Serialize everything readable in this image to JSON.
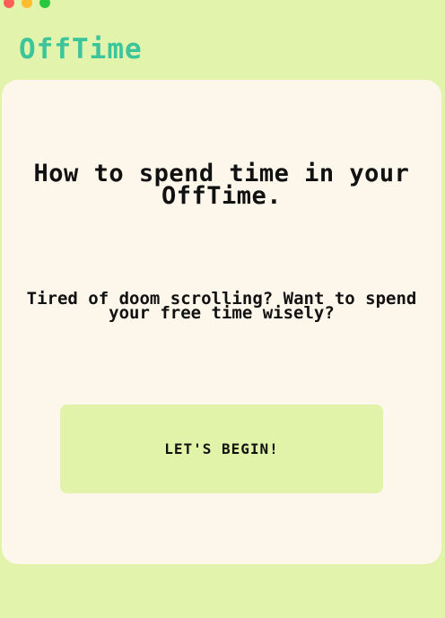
{
  "window": {
    "controls": [
      "close",
      "minimize",
      "maximize"
    ]
  },
  "app": {
    "logo": "OffTime"
  },
  "hero": {
    "headline": "How to spend time in your OffTime.",
    "subtext": "Tired of doom scrolling? Want to spend your free time wisely?"
  },
  "actions": {
    "begin_label": "LET'S BEGIN!"
  },
  "colors": {
    "background": "#e2f3ab",
    "card": "#fdf6ea",
    "logo": "#3cc59a",
    "button": "#e1f3a8",
    "text": "#111111"
  }
}
